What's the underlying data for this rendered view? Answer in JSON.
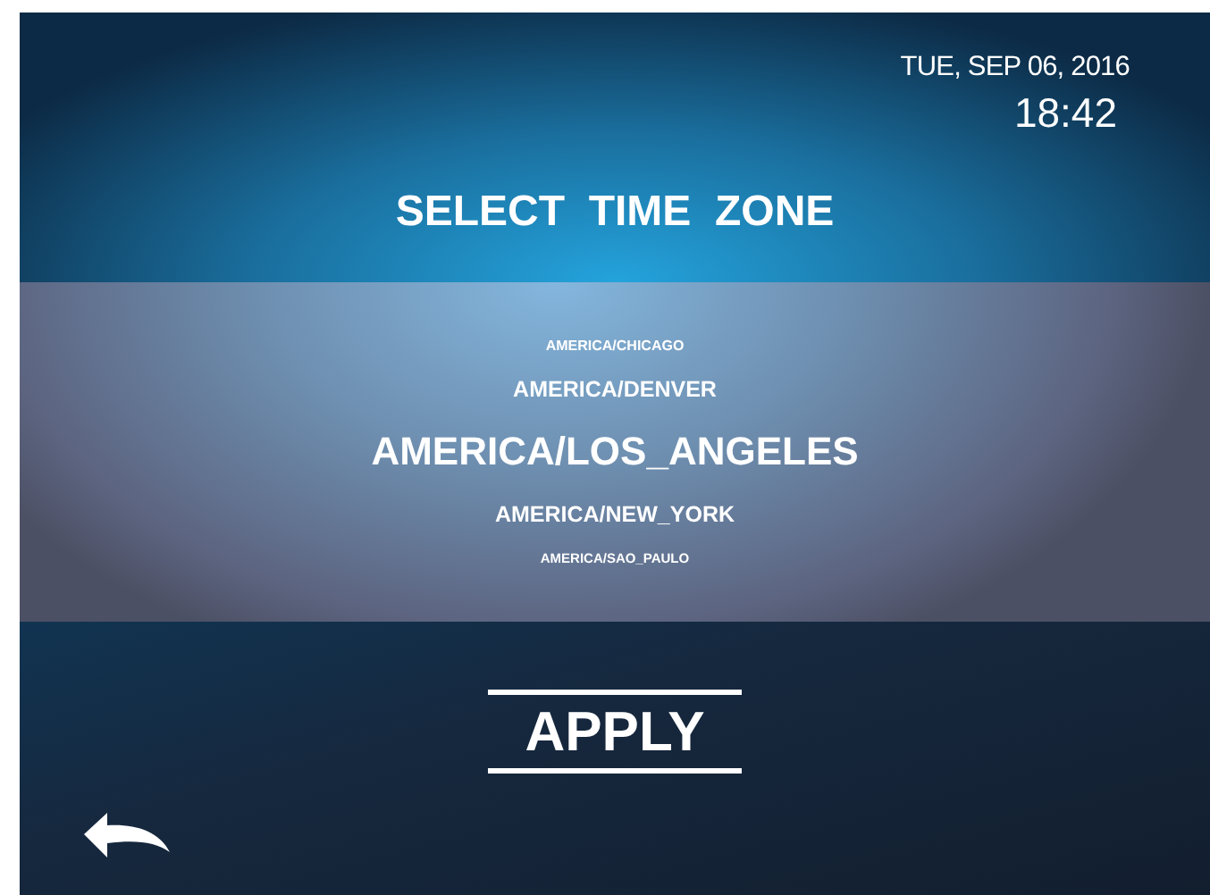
{
  "date": "TUE, SEP 06, 2016",
  "time": "18:42",
  "title": "SELECT  TIME  ZONE",
  "zones": [
    {
      "label": "AMERICA/CHICAGO",
      "selected": false
    },
    {
      "label": "AMERICA/DENVER",
      "selected": false
    },
    {
      "label": "AMERICA/LOS_ANGELES",
      "selected": true
    },
    {
      "label": "AMERICA/NEW_YORK",
      "selected": false
    },
    {
      "label": "AMERICA/SAO_PAULO",
      "selected": false
    }
  ],
  "apply_button": "APPLY"
}
